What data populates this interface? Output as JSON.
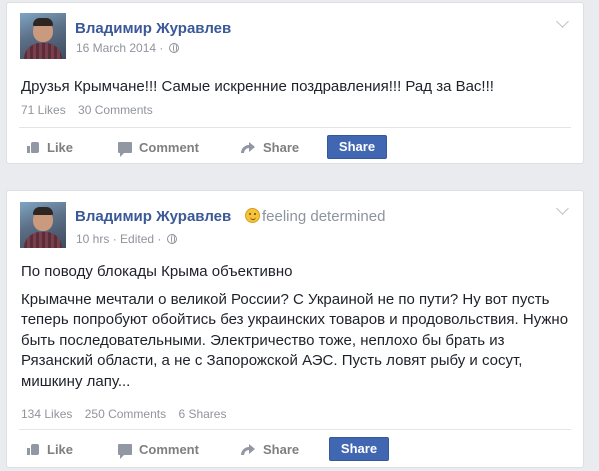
{
  "posts": [
    {
      "author": "Владимир Журавлев",
      "feeling": "",
      "timestamp": "16 March 2014",
      "edited": "",
      "separator": "·",
      "paragraphs": [
        "Друзья Крымчане!!! Самые искренние поздравления!!! Рад за Вас!!!"
      ],
      "stats": {
        "likes": "71 Likes",
        "comments": "30 Comments",
        "shares": ""
      },
      "actions": {
        "like": "Like",
        "comment": "Comment",
        "share": "Share",
        "share_button": "Share"
      },
      "icons": {
        "avatar": "profile-photo",
        "privacy": "globe-icon",
        "menu": "chevron-down-icon"
      }
    },
    {
      "author": "Владимир Журавлев",
      "feeling": "feeling determined",
      "timestamp": "10 hrs",
      "edited": "Edited",
      "separator": "·",
      "paragraphs": [
        "По поводу блокады Крыма объективно",
        "Крымачне мечтали о великой России? С Украиной не по пути? Ну вот пусть теперь попробуют обойтись без украинских товаров и продовольствия. Нужно быть последовательными. Электричество тоже, неплохо бы брать из Рязанский области, а не с Запорожской АЭС. Пусть ловят рыбу и сосут, мишкину лапу..."
      ],
      "stats": {
        "likes": "134 Likes",
        "comments": "250 Comments",
        "shares": "6 Shares"
      },
      "actions": {
        "like": "Like",
        "comment": "Comment",
        "share": "Share",
        "share_button": "Share"
      },
      "icons": {
        "avatar": "profile-photo",
        "feeling": "determined-emoji-icon",
        "privacy": "globe-icon",
        "menu": "chevron-down-icon"
      }
    }
  ],
  "colors": {
    "link": "#3b5998",
    "share_button": "#4267b2",
    "meta": "#90949c",
    "background": "#e9ebee"
  }
}
